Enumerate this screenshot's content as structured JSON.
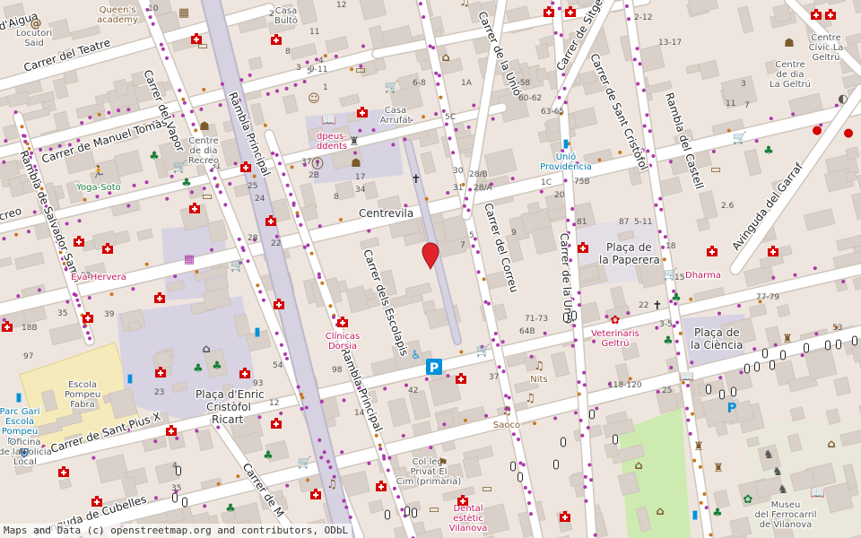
{
  "colors": {
    "land": "#eee6de",
    "building": "#d9d0c9",
    "road": "#ffffff",
    "pedestrian": "#d6d2e2",
    "square": "#c8c4d8",
    "park": "#cdebb0",
    "school": "#f5eab9",
    "health": "#d40000",
    "poi_brown": "#7c5a2c",
    "poi_purple": "#ac39ac",
    "poi_green": "#1a7f3a",
    "poi_blue": "#0092da",
    "marker": "#e0242a"
  },
  "streets": [
    {
      "id": "carrer-del-teatre",
      "text": "Carrer del Teatre"
    },
    {
      "id": "carrer-de-manuel-tomas",
      "text": "Carrer de Manuel Tomàs"
    },
    {
      "id": "carrer-del-vapor",
      "text": "Carrer del Vapor"
    },
    {
      "id": "rambla-principal-north",
      "text": "Rambla Principal"
    },
    {
      "id": "rambla-principal-south",
      "text": "Rambla Principal"
    },
    {
      "id": "rambla-de-salvador-samà",
      "text": "Rambla de Salvador Samà"
    },
    {
      "id": "carrer-de-la-unio-north",
      "text": "Carrer de la Unió"
    },
    {
      "id": "carrer-de-la-unio-south",
      "text": "Carrer de la Unió"
    },
    {
      "id": "carrer-de-sitges",
      "text": "Carrer de Sitges"
    },
    {
      "id": "carrer-de-sant-cristofol",
      "text": "Carrer de Sant Cristòfol"
    },
    {
      "id": "rambla-del-castell",
      "text": "Rambla del Castell"
    },
    {
      "id": "avinguda-del-garraf",
      "text": "Avinguda del Garraf"
    },
    {
      "id": "carrer-del-correu",
      "text": "Carrer del Correu"
    },
    {
      "id": "carrer-dels-escolapis",
      "text": "Carrer dels Escolapis"
    },
    {
      "id": "carrer-de-sant-pius-x",
      "text": "Carrer de Sant Pius X"
    },
    {
      "id": "avinguda-de-cubelles",
      "text": "Avinguda de Cubelles"
    },
    {
      "id": "carrer-de-m",
      "text": "Carrer de M"
    },
    {
      "id": "carrer-d-aigua",
      "text": "d'Aigua"
    },
    {
      "id": "carrer-creo",
      "text": "creo"
    }
  ],
  "areas": {
    "centrevila": "Centrevila",
    "placa_paperera": [
      "Plaça de",
      "la Paperera"
    ],
    "placa_ciencia": [
      "Plaça de",
      "la Ciència"
    ],
    "placa_enric": [
      "Plaça d'Enric",
      "Cristòfol",
      "Ricart"
    ]
  },
  "places": [
    {
      "id": "queens-academy",
      "lines": [
        "Queen's",
        "academy"
      ],
      "kind": "brown"
    },
    {
      "id": "locutori-said",
      "lines": [
        "Locutori",
        "Said"
      ],
      "kind": "gray"
    },
    {
      "id": "casa-bulto",
      "lines": [
        "Casa",
        "Bultó"
      ],
      "kind": "gray"
    },
    {
      "id": "casa-arrufat",
      "lines": [
        "Casa",
        "Arrufat"
      ],
      "kind": "gray"
    },
    {
      "id": "centre-civic",
      "lines": [
        "Centre",
        "Cívic La",
        "Geltrú"
      ],
      "kind": "gray"
    },
    {
      "id": "centre-dia-geltru",
      "lines": [
        "Centre",
        "de dia",
        "La Geltrú"
      ],
      "kind": "gray"
    },
    {
      "id": "centre-dia-recreo",
      "lines": [
        "Centre",
        "de dia",
        "Recreo"
      ],
      "kind": "gray"
    },
    {
      "id": "dpeus",
      "lines": [
        "dpeus-",
        "ddents"
      ],
      "kind": "red"
    },
    {
      "id": "yoga-soto",
      "lines": [
        "Yoga-Soto"
      ],
      "kind": "green"
    },
    {
      "id": "eva-hervera",
      "lines": [
        "Eva Hervera"
      ],
      "kind": "red"
    },
    {
      "id": "unio-providencia",
      "lines": [
        "Unió",
        "Providència"
      ],
      "kind": "blue"
    },
    {
      "id": "dharma",
      "lines": [
        "Dharma"
      ],
      "kind": "red"
    },
    {
      "id": "veterinaris",
      "lines": [
        "Veterinaris",
        "Geltrú"
      ],
      "kind": "red"
    },
    {
      "id": "clinicas-dorsia",
      "lines": [
        "Clínicas",
        "Dorsia"
      ],
      "kind": "red"
    },
    {
      "id": "escola-pompeu",
      "lines": [
        "Escola",
        "Pompeu",
        "Fabra"
      ],
      "kind": "gray"
    },
    {
      "id": "parc-gari",
      "lines": [
        "Parc Garí",
        "Escola",
        "Pompeu",
        "Fabra"
      ],
      "kind": "blue"
    },
    {
      "id": "oficina-policia",
      "lines": [
        "Oficina",
        "de la Policia",
        "Local"
      ],
      "kind": "gray"
    },
    {
      "id": "nits",
      "lines": [
        "Nits"
      ],
      "kind": "brown"
    },
    {
      "id": "saoco",
      "lines": [
        "Saoco"
      ],
      "kind": "brown"
    },
    {
      "id": "col-legi",
      "lines": [
        "Col·legi",
        "Privat El",
        "Cim (primària)"
      ],
      "kind": "gray"
    },
    {
      "id": "dental-estetic",
      "lines": [
        "Dental",
        "estètic",
        "Vilanova"
      ],
      "kind": "red"
    },
    {
      "id": "museu",
      "lines": [
        "Museu",
        "del Ferrocarril",
        "de Vilanova"
      ],
      "kind": "gray"
    }
  ],
  "house_numbers": [
    "10",
    "2",
    "11",
    "4",
    "8",
    "1",
    "3",
    "5",
    "9-11",
    "12",
    "6-8",
    "5C",
    "1A",
    "56-58",
    "60-62",
    "63-65",
    "2-12",
    "13-17",
    "11",
    "3",
    "7",
    "34",
    "30",
    "28/B",
    "28/A",
    "31",
    "75B",
    "1C",
    "20",
    "81",
    "87",
    "5-11",
    "18",
    "2.6",
    "9",
    "5",
    "7",
    "15",
    "22",
    "3-5",
    "77-79",
    "53",
    "71-73",
    "64B",
    "118-120",
    "98",
    "37",
    "25",
    "42",
    "14",
    "18B",
    "23",
    "39",
    "35",
    "35",
    "92",
    "97",
    "93",
    "54",
    "12",
    "4",
    "28",
    "31",
    "22",
    "24",
    "25",
    "37",
    "2B",
    "8",
    "17",
    "24",
    "14"
  ],
  "attribution": "Maps and Data (c) openstreetmap.org and contributors, ODbL"
}
